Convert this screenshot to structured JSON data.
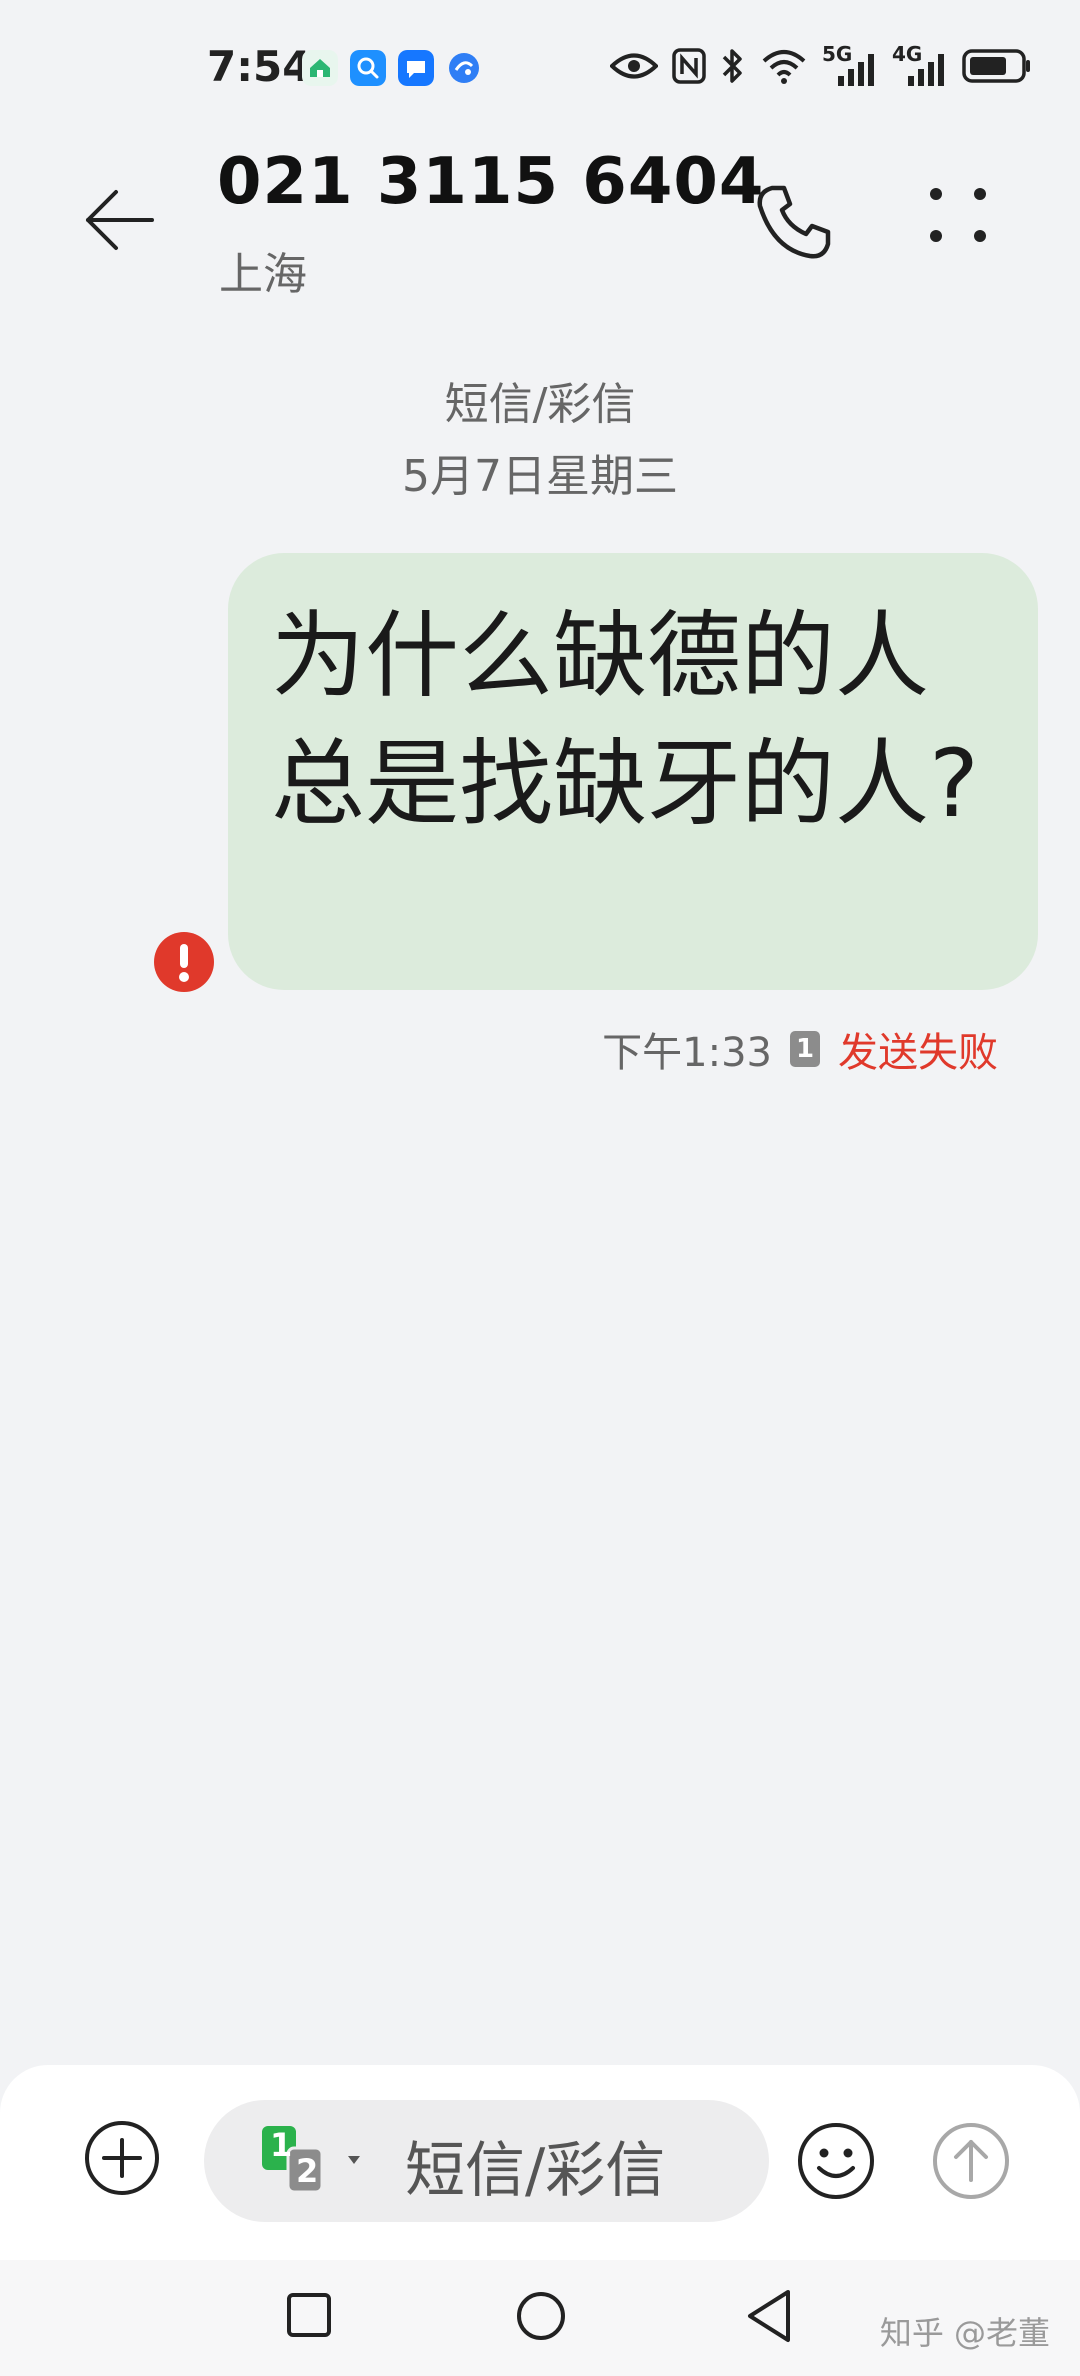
{
  "status_bar": {
    "time": "7:54",
    "apps": [
      {
        "icon": "home-app-icon",
        "color": "#2bb673"
      },
      {
        "icon": "search-app-icon",
        "color": "#1e90ff"
      },
      {
        "icon": "chat-app-icon",
        "color": "#1677ff"
      },
      {
        "icon": "browser-app-icon",
        "color": "#2f7ef5"
      }
    ],
    "indicators": [
      "eye-icon",
      "nfc-icon",
      "bluetooth-icon",
      "wifi-icon",
      "5g-signal-icon",
      "4g-signal-icon",
      "battery-icon"
    ],
    "network_5g": "5G",
    "network_4g": "4G"
  },
  "header": {
    "title": "021 3115 6404",
    "subtitle": "上海"
  },
  "conversation": {
    "type_label": "短信/彩信",
    "date_label": "5月7日星期三"
  },
  "message": {
    "text": "为什么缺德的人总是找缺牙的人?",
    "time": "下午1:33",
    "sim": "1",
    "status": "发送失败",
    "bubble_color": "#dcebdc",
    "status_color": "#e0392b"
  },
  "composer": {
    "placeholder": "短信/彩信",
    "sim_primary": "1",
    "sim_secondary": "2"
  },
  "watermark": "知乎 @老董"
}
